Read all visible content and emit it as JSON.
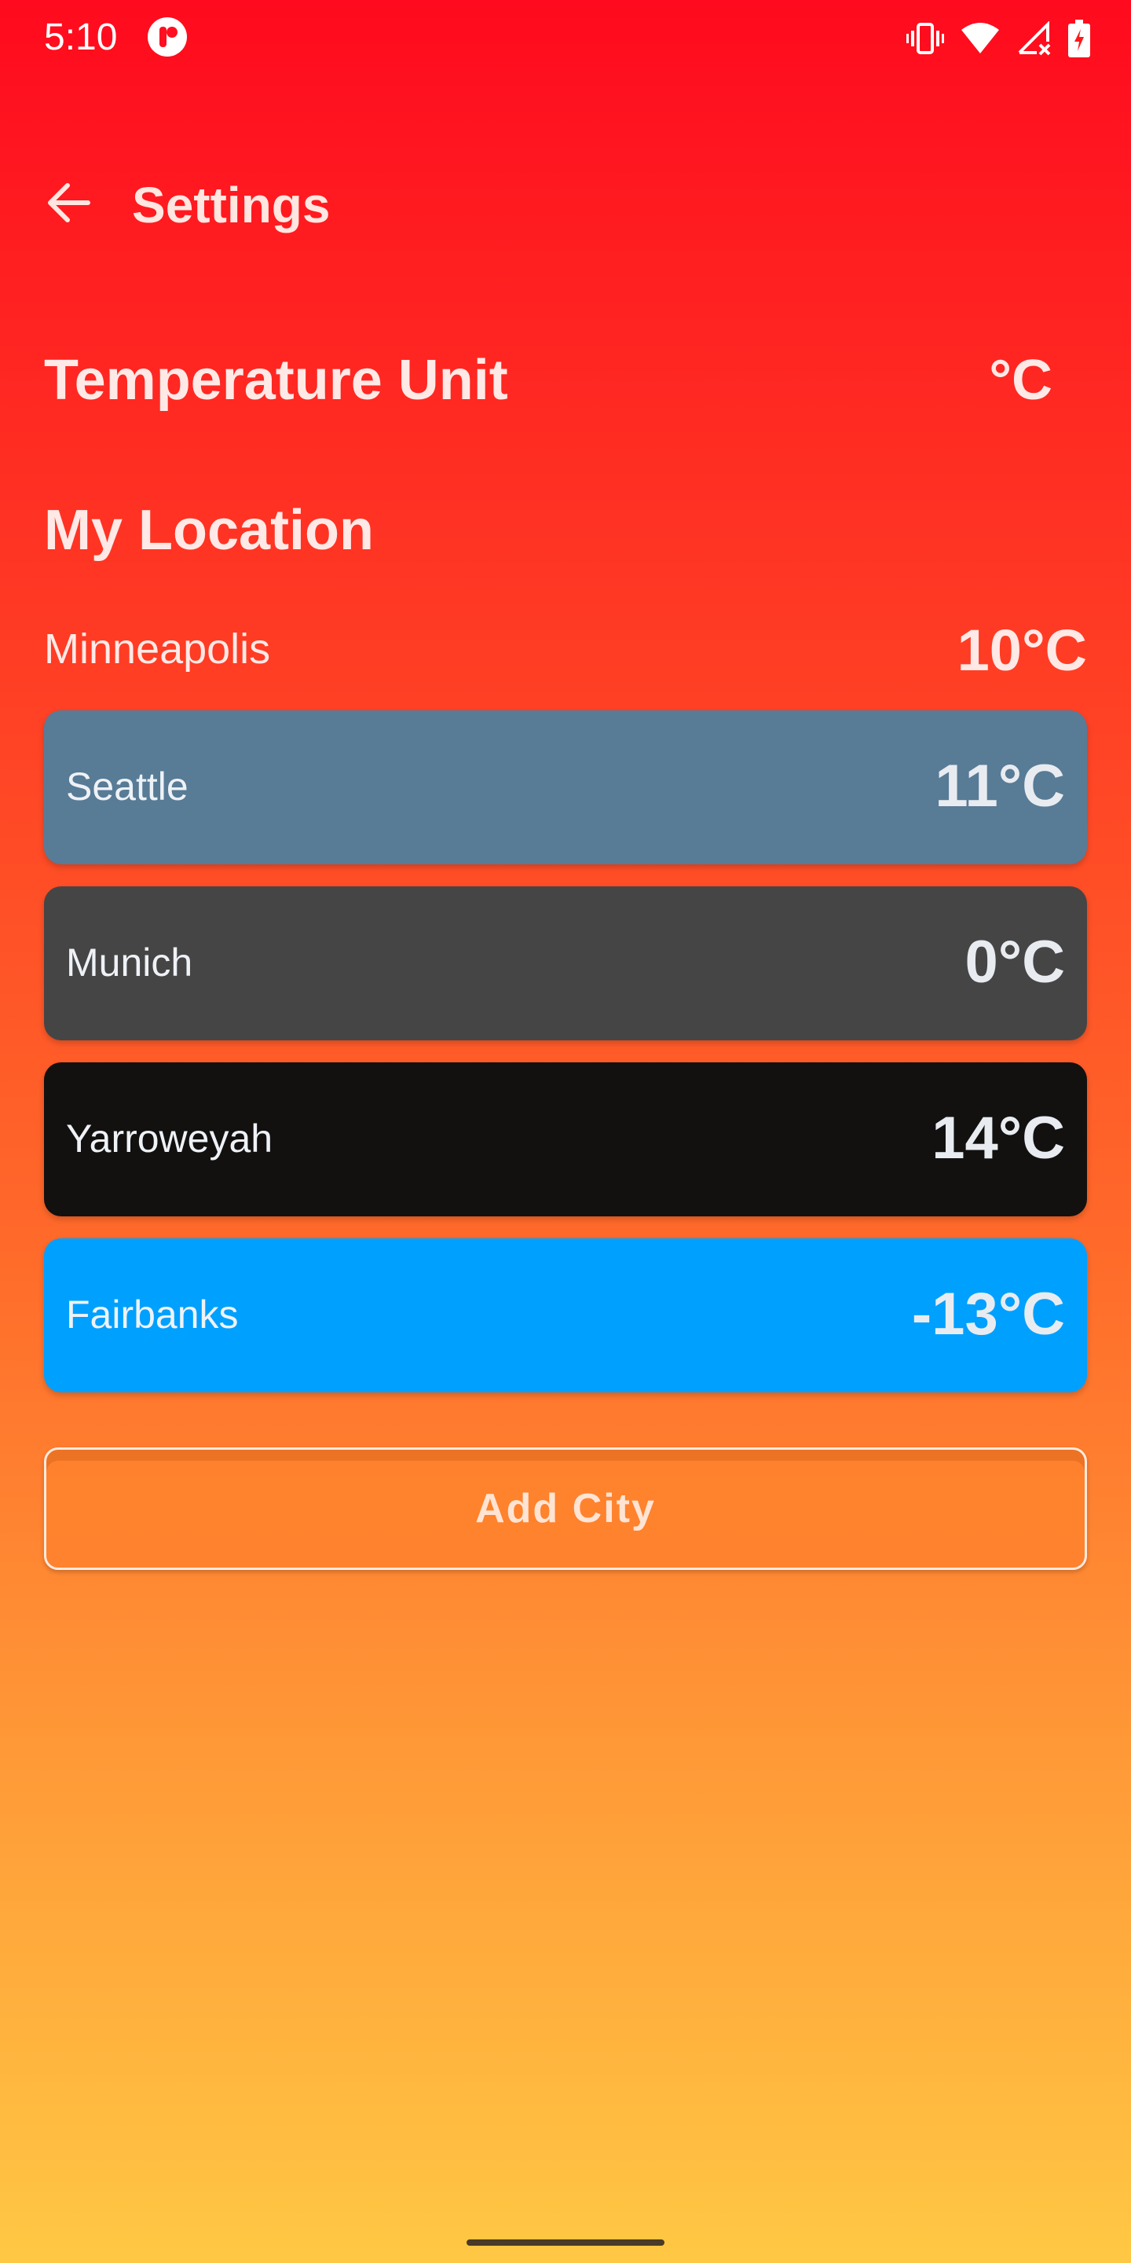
{
  "theme": {
    "gradient_top": "#ff0a1e",
    "gradient_mid": "#ff6a2a",
    "gradient_bottom": "#ffc844"
  },
  "status_bar": {
    "time": "5:10",
    "icons": [
      "app-notification-icon",
      "vibrate-icon",
      "wifi-icon",
      "no-signal-icon",
      "battery-charging-icon"
    ]
  },
  "app_bar": {
    "back_icon": "arrow-left-icon",
    "title": "Settings"
  },
  "temperature_unit": {
    "label": "Temperature Unit",
    "value": "°C"
  },
  "my_location": {
    "section_title": "My Location",
    "city": "Minneapolis",
    "temperature": "10°C"
  },
  "cities": [
    {
      "name": "Seattle",
      "temperature": "11°C",
      "color": "#587b96"
    },
    {
      "name": "Munich",
      "temperature": "0°C",
      "color": "#464545"
    },
    {
      "name": "Yarroweyah",
      "temperature": "14°C",
      "color": "#121110"
    },
    {
      "name": "Fairbanks",
      "temperature": "-13°C",
      "color": "#00a0fe"
    }
  ],
  "add_city": {
    "label": "Add City"
  }
}
